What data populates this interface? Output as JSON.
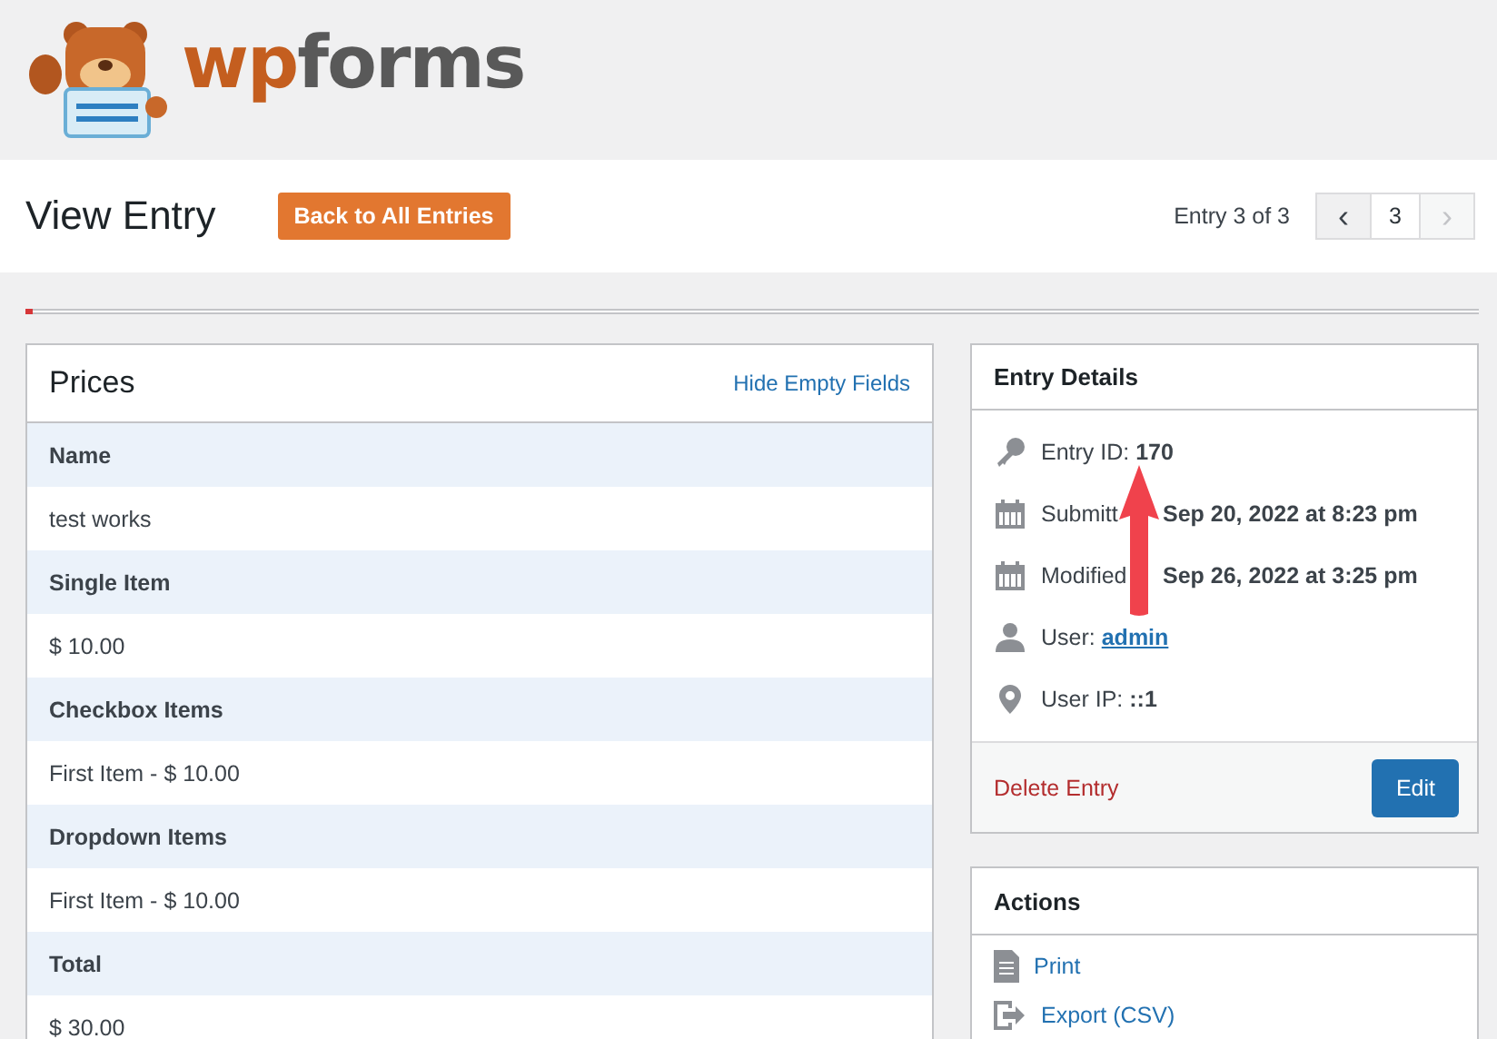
{
  "logo": {
    "part_1": "wp",
    "part_2": "forms"
  },
  "page": {
    "title": "View Entry",
    "back_button": "Back to All Entries",
    "entry_count": "Entry 3 of 3",
    "pager": {
      "prev": "‹",
      "current": "3",
      "next": "›",
      "next_disabled": true
    }
  },
  "progress": {
    "level": 0.005
  },
  "form": {
    "title": "Prices",
    "hide_link": "Hide Empty Fields",
    "fields": [
      {
        "label": "Name",
        "value": "test works"
      },
      {
        "label": "Single Item",
        "value": "$ 10.00"
      },
      {
        "label": "Checkbox Items",
        "value": "First Item - $ 10.00"
      },
      {
        "label": "Dropdown Items",
        "value": "First Item - $ 10.00"
      },
      {
        "label": "Total",
        "value": "$ 30.00"
      }
    ]
  },
  "entry_details": {
    "title": "Entry Details",
    "items": [
      {
        "kind": "key",
        "label": "Entry ID:",
        "value": "170"
      },
      {
        "kind": "calendar",
        "label": "Submitt",
        "value": "Sep 20, 2022 at 8:23 pm",
        "covered": true
      },
      {
        "kind": "calendar",
        "label": "Modified",
        "value": "Sep 26, 2022 at 3:25 pm",
        "covered": true
      },
      {
        "kind": "user",
        "label": "User:",
        "link": "admin"
      },
      {
        "kind": "pin",
        "label": "User IP:",
        "value": "::1"
      }
    ],
    "delete": "Delete Entry",
    "edit": "Edit"
  },
  "actions": {
    "title": "Actions",
    "items": [
      {
        "kind": "print",
        "label": "Print"
      },
      {
        "kind": "export",
        "label": "Export (CSV)"
      }
    ]
  }
}
